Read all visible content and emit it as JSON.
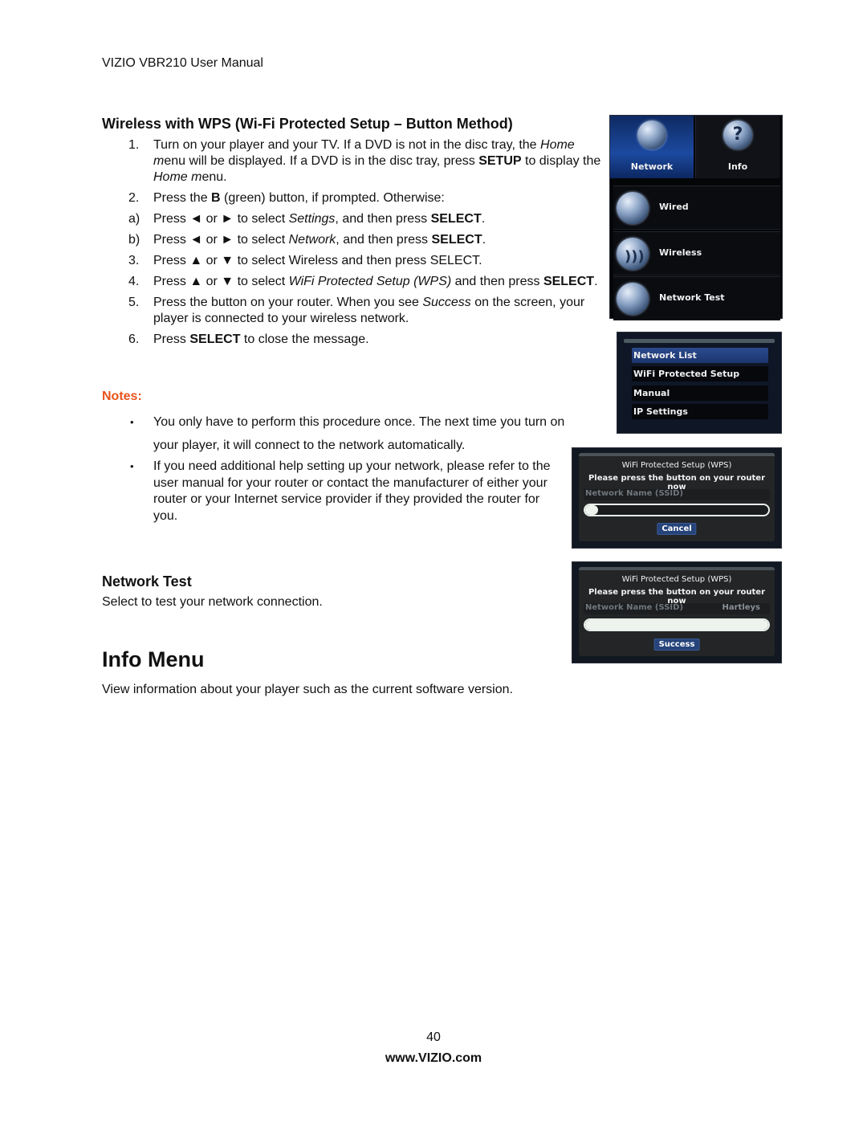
{
  "header": {
    "running_title": "VIZIO VBR210 User Manual"
  },
  "wps_section": {
    "heading": "Wireless with WPS (Wi-Fi Protected Setup – Button Method)",
    "steps": [
      {
        "num": "1.",
        "parts": [
          {
            "t": "Turn on your player and your TV. If a DVD is not in the disc tray, the "
          },
          {
            "t": "Home m",
            "style": "i"
          },
          {
            "t": "enu will be displayed. If a DVD is in the disc tray, press "
          },
          {
            "t": "SETUP",
            "style": "b"
          },
          {
            "t": " to display the "
          },
          {
            "t": "Home m",
            "style": "i"
          },
          {
            "t": "enu."
          }
        ]
      },
      {
        "num": "2.",
        "parts": [
          {
            "t": "Press the "
          },
          {
            "t": "B",
            "style": "b"
          },
          {
            "t": " (green) button, if prompted. Otherwise:"
          }
        ]
      },
      {
        "num": "a)",
        "sub": true,
        "parts": [
          {
            "t": "Press ◄ or ► to select "
          },
          {
            "t": "Settings",
            "style": "i"
          },
          {
            "t": ", and then press "
          },
          {
            "t": "SELECT",
            "style": "b"
          },
          {
            "t": "."
          }
        ]
      },
      {
        "num": "b)",
        "sub": true,
        "parts": [
          {
            "t": "Press ◄ or ► to select "
          },
          {
            "t": "Network",
            "style": "i"
          },
          {
            "t": ", and then press "
          },
          {
            "t": "SELECT",
            "style": "b"
          },
          {
            "t": "."
          }
        ]
      },
      {
        "num": "3.",
        "parts": [
          {
            "t": "Press ▲ or ▼ to select Wireless and then press SELECT."
          }
        ]
      },
      {
        "num": "4.",
        "parts": [
          {
            "t": "Press ▲ or ▼ to select "
          },
          {
            "t": "WiFi Protected Setup (WPS)",
            "style": "i"
          },
          {
            "t": " and then press "
          },
          {
            "t": "SELECT",
            "style": "b"
          },
          {
            "t": "."
          }
        ]
      },
      {
        "num": "5.",
        "parts": [
          {
            "t": "Press the button on your router. When you see "
          },
          {
            "t": "Success",
            "style": "i"
          },
          {
            "t": " on the screen, your player is connected to your wireless network."
          }
        ]
      },
      {
        "num": "6.",
        "parts": [
          {
            "t": "Press "
          },
          {
            "t": "SELECT",
            "style": "b"
          },
          {
            "t": " to close the message."
          }
        ]
      }
    ]
  },
  "notes": {
    "label": "Notes:",
    "items": [
      "You only have to perform this procedure once. The next time you turn on your player, it will connect to the network automatically.",
      "If you need additional help setting up your network, please refer to the user manual for your router or contact the manufacturer of either your router or your Internet service provider if they provided the router for you."
    ],
    "bullet": "•"
  },
  "network_test": {
    "heading": "Network Test",
    "body": "Select to test your network connection."
  },
  "info_menu": {
    "heading": "Info Menu",
    "body": "View information about your player such as the current software version."
  },
  "screens": {
    "home_menu": {
      "tabs": [
        {
          "label": "Network",
          "icon": "globe-icon",
          "selected": true
        },
        {
          "label": "Info",
          "icon": "question-icon",
          "glyph": "?"
        }
      ],
      "items": [
        {
          "label": "Wired",
          "icon": "wired-globe-icon"
        },
        {
          "label": "Wireless",
          "icon": "wifi-icon",
          "glyph": ")))"
        },
        {
          "label": "Network Test",
          "icon": "network-test-icon"
        }
      ]
    },
    "network_submenu": {
      "items": [
        {
          "label": "Network List",
          "selected": true
        },
        {
          "label": "WiFi Protected Setup (WPS)"
        },
        {
          "label": "Manual"
        },
        {
          "label": "IP Settings"
        }
      ]
    },
    "wps_pending": {
      "title": "WiFi Protected Setup (WPS)",
      "message": "Please press the button on your router now",
      "ssid_label": "Network Name (SSID)",
      "ssid_value": "",
      "progress": 0.07,
      "button": "Cancel"
    },
    "wps_success": {
      "title": "WiFi Protected Setup (WPS)",
      "message": "Please press the button on your router now",
      "ssid_label": "Network Name (SSID)",
      "ssid_value": "Hartleys",
      "progress": 1.0,
      "button": "Success"
    }
  },
  "footer": {
    "page_number": "40",
    "url": "www.VIZIO.com"
  }
}
